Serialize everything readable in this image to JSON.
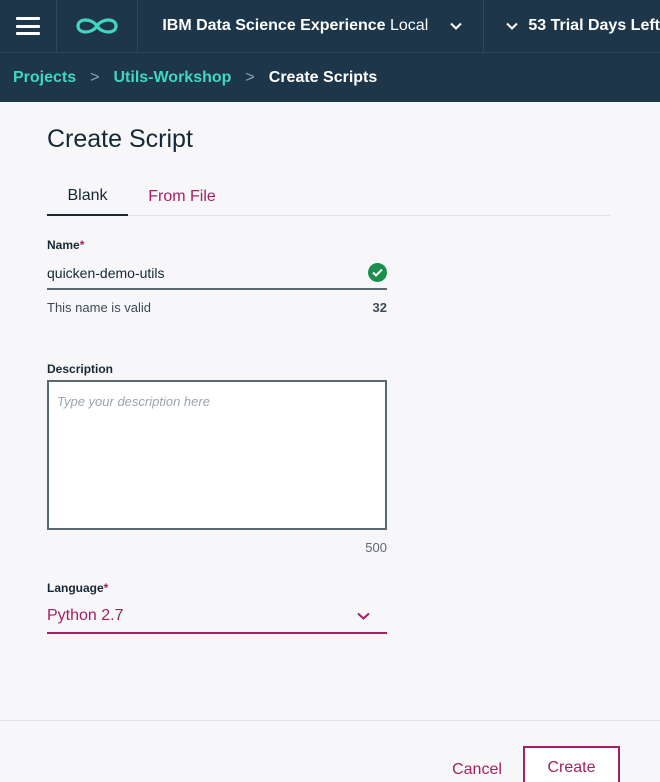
{
  "header": {
    "menu_icon": "hamburger-icon",
    "logo_icon": "infinity-logo-icon",
    "app_title_bold": "IBM Data Science Experience",
    "app_title_light": "Local",
    "trial_text": "53 Trial Days Left",
    "accent_color": "#41d6c3"
  },
  "breadcrumb": {
    "items": [
      "Projects",
      "Utils-Workshop"
    ],
    "current": "Create Scripts",
    "separator": ">"
  },
  "page": {
    "title": "Create Script"
  },
  "tabs": {
    "items": [
      "Blank",
      "From File"
    ],
    "active": "Blank"
  },
  "form": {
    "name": {
      "label": "Name",
      "required_mark": "*",
      "value": "quicken-demo-utils",
      "hint": "This name is valid",
      "count": "32",
      "status_icon": "checkmark-circle-icon",
      "status_color": "#1d8f4c"
    },
    "description": {
      "label": "Description",
      "placeholder": "Type your description here",
      "count": "500"
    },
    "language": {
      "label": "Language",
      "required_mark": "*",
      "value": "Python 2.7"
    }
  },
  "footer": {
    "cancel_label": "Cancel",
    "create_label": "Create",
    "brand_color": "#a51f61"
  }
}
